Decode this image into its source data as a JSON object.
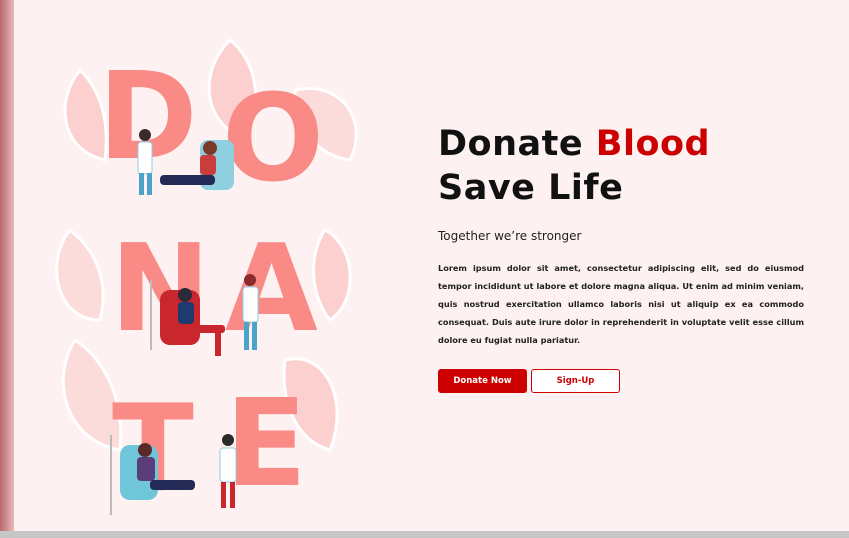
{
  "illustration": {
    "letters": [
      "D",
      "O",
      "N",
      "A",
      "T",
      "E"
    ]
  },
  "hero": {
    "headline_part1": "Donate ",
    "headline_accent": "Blood",
    "headline_line2": "Save Life",
    "tagline": "Together we’re stronger",
    "body": "Lorem ipsum dolor sit amet, consectetur adipiscing elit, sed do eiusmod tempor incididunt ut labore et dolore magna aliqua. Ut enim ad minim veniam, quis nostrud exercitation ullamco laboris nisi ut aliquip ex ea commodo consequat. Duis aute irure dolor in reprehenderit in voluptate velit esse cillum dolore eu fugiat nulla pariatur."
  },
  "actions": {
    "donate_label": "Donate Now",
    "signup_label": "Sign-Up"
  },
  "colors": {
    "accent": "#cc0000",
    "letters": "#f98a86",
    "background": "#fdf1f1"
  }
}
